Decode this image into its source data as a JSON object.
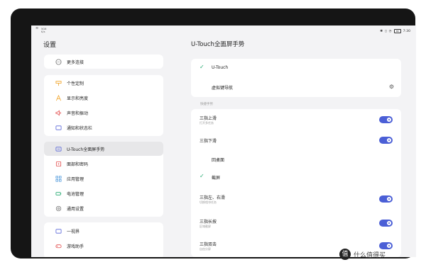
{
  "status_bar": {
    "net_top": "5G6",
    "net_bottom": "K/s",
    "time": "7:30",
    "battery": "88"
  },
  "left": {
    "title": "设置",
    "group1": [
      {
        "label": "更多连接",
        "icon": "more-connections-icon"
      }
    ],
    "group2": [
      {
        "label": "个性定制",
        "icon": "personalize-icon"
      },
      {
        "label": "显示和亮度",
        "icon": "display-icon"
      },
      {
        "label": "声音和振动",
        "icon": "sound-icon"
      },
      {
        "label": "通知和状态栏",
        "icon": "notification-icon"
      }
    ],
    "group3": [
      {
        "label": "U-Touch全面屏手势",
        "icon": "gesture-icon",
        "active": true
      },
      {
        "label": "面部和密码",
        "icon": "face-lock-icon"
      },
      {
        "label": "应用管理",
        "icon": "apps-icon"
      },
      {
        "label": "电池管理",
        "icon": "battery-icon"
      },
      {
        "label": "通用设置",
        "icon": "general-settings-icon"
      }
    ],
    "group4": [
      {
        "label": "一视界",
        "icon": "vision-icon"
      },
      {
        "label": "游戏助手",
        "icon": "game-icon"
      }
    ]
  },
  "right": {
    "title": "U-Touch全面屏手势",
    "mode_card": {
      "utouch": "U-Touch",
      "virtual_nav": "虚拟键导航"
    },
    "section_label": "快捷手势",
    "gestures": [
      {
        "title": "三指上滑",
        "subtitle": "打开多任务",
        "toggle": true
      },
      {
        "title": "三指下滑",
        "subtitle": "",
        "toggle": true
      },
      {
        "title": "回桌面",
        "subtitle": "",
        "option": true
      },
      {
        "title": "截屏",
        "subtitle": "",
        "option": true,
        "checked": true
      },
      {
        "title": "三指左、右滑",
        "subtitle": "切换相邻任务",
        "toggle": true
      },
      {
        "title": "三指长按",
        "subtitle": "区域截屏",
        "toggle": true
      },
      {
        "title": "三指双击",
        "subtitle": "自由分屏",
        "toggle": true
      }
    ]
  },
  "watermark": {
    "logo": "值",
    "text": "什么值得买"
  },
  "colors": {
    "accent": "#4b5fd6",
    "check": "#21a86f"
  }
}
